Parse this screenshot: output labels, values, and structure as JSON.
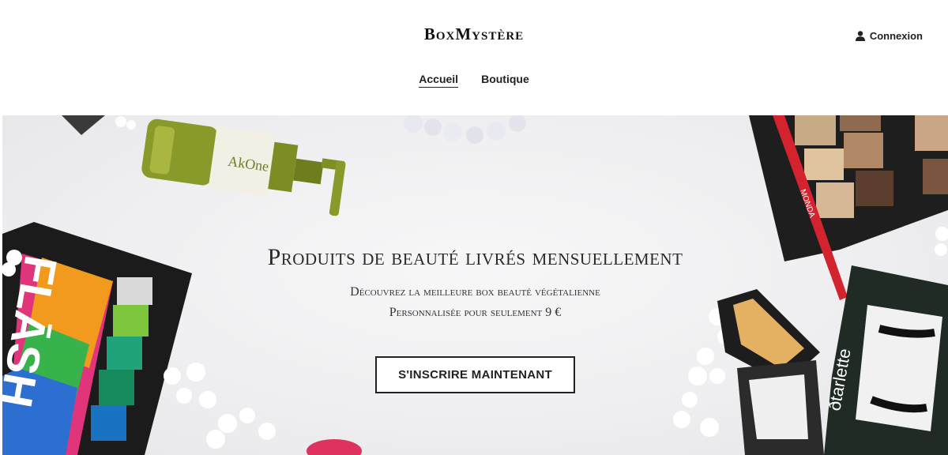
{
  "header": {
    "brand": "BoxMystère",
    "login_label": "Connexion",
    "nav": [
      {
        "label": "Accueil",
        "active": true
      },
      {
        "label": "Boutique",
        "active": false
      }
    ]
  },
  "hero": {
    "title": "Produits de beauté livrés mensuellement",
    "subtitle_line1": "Découvrez la meilleure box beauté végétalienne",
    "subtitle_line2": "Personnalisée pour seulement 9 €",
    "cta_label": "S'INSCRIRE MAINTENANT",
    "photo_texts": {
      "serum_label": "AkOne",
      "eyeliner_brand": "MONDA",
      "palette_brand": "FLĀSH",
      "lashes_brand": "ðtarlette"
    }
  },
  "icons": {
    "login": "user-icon"
  },
  "colors": {
    "text": "#222222",
    "background": "#ffffff",
    "button_border": "#222222"
  }
}
